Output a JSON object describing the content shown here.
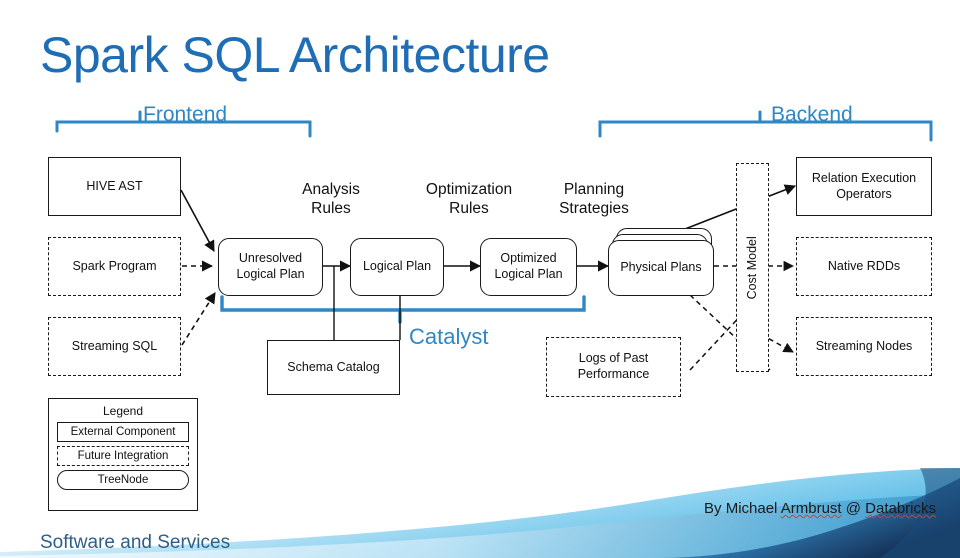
{
  "slide": {
    "title": "Spark SQL Architecture",
    "footer": "Software and Services",
    "credit": {
      "prefix": "By Michael ",
      "name": "Armbrust",
      "at": " @ ",
      "company": "Databricks"
    },
    "accent_blue": "#1f6eb5",
    "label_blue": "#2f87c4",
    "footer_blue": "#2e5f86"
  },
  "sections": {
    "frontend": "Frontend",
    "backend": "Backend",
    "catalyst": "Catalyst"
  },
  "stage_labels": [
    {
      "line1": "Analysis",
      "line2": "Rules"
    },
    {
      "line1": "Optimization",
      "line2": "Rules"
    },
    {
      "line1": "Planning",
      "line2": "Strategies"
    }
  ],
  "nodes": {
    "hive_ast": {
      "label": "HIVE AST",
      "kind": "external"
    },
    "spark_program": {
      "label": "Spark Program",
      "kind": "future"
    },
    "streaming_sql": {
      "label": "Streaming SQL",
      "kind": "future"
    },
    "unresolved": {
      "label": "Unresolved\nLogical Plan",
      "kind": "treenode"
    },
    "logical_plan": {
      "label": "Logical Plan",
      "kind": "treenode"
    },
    "optimized": {
      "label": "Optimized\nLogical Plan",
      "kind": "treenode"
    },
    "physical_plans": {
      "label": "Physical Plans",
      "kind": "treenode"
    },
    "schema_catalog": {
      "label": "Schema Catalog",
      "kind": "external"
    },
    "logs_past": {
      "label": "Logs of Past\nPerformance",
      "kind": "future"
    },
    "cost_model": {
      "label": "Cost Model",
      "kind": "future"
    },
    "relation_ops": {
      "label": "Relation Execution\nOperators",
      "kind": "external"
    },
    "native_rdds": {
      "label": "Native RDDs",
      "kind": "future"
    },
    "streaming_nodes": {
      "label": "Streaming Nodes",
      "kind": "future"
    }
  },
  "legend": {
    "title": "Legend",
    "items": [
      {
        "label": "External Component",
        "kind": "solid"
      },
      {
        "label": "Future Integration",
        "kind": "dashed"
      },
      {
        "label": "TreeNode",
        "kind": "rounded"
      }
    ]
  }
}
